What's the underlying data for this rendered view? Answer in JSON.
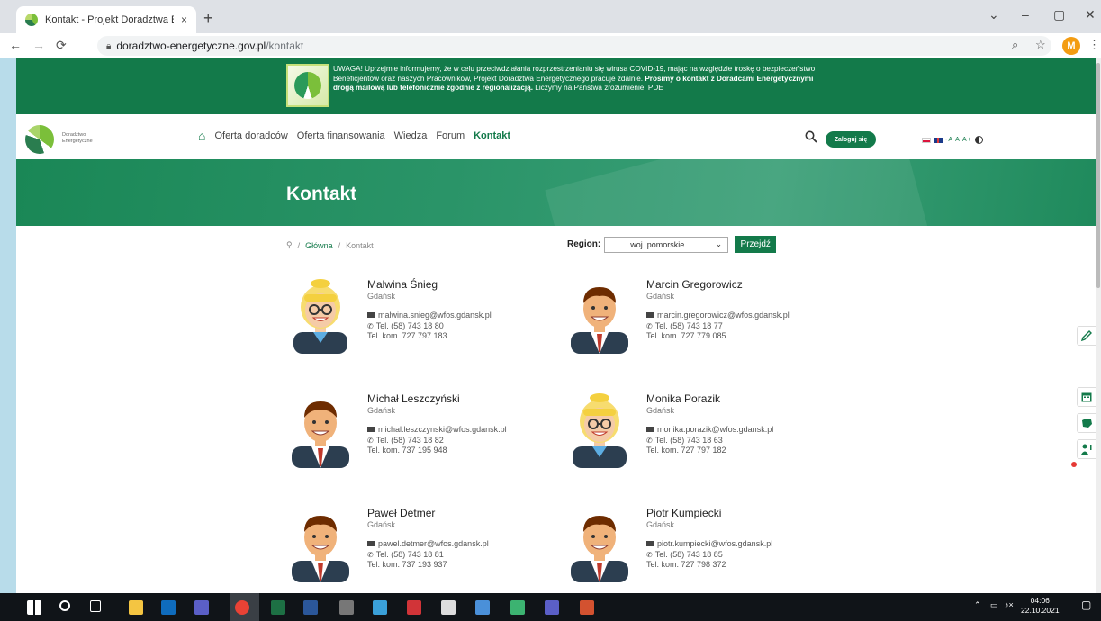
{
  "browser": {
    "tab_title": "Kontakt - Projekt Doradztwa Ene",
    "tab_close": "×",
    "new_tab": "+",
    "url_host": "doradztwo-energetyczne.gov.pl",
    "url_path": "/kontakt",
    "profile_initial": "M",
    "window_controls": {
      "dropdown": "⌄",
      "minimize": "–",
      "maximize": "▢",
      "close": "✕"
    }
  },
  "alert": {
    "text": "UWAGA! Uprzejmie informujemy, że w celu przeciwdziałania rozprzestrzenianiu się wirusa COVID-19, mając na względzie troskę o bezpieczeństwo Beneficjentów oraz naszych Pracowników, Projekt Doradztwa Energetycznego pracuje zdalnie.",
    "bold_text": "Prosimy o kontakt z Doradcami Energetycznymi drogą mailową lub telefonicznie zgodnie z regionalizacją.",
    "tail_text": "Liczymy na Państwa zrozumienie. PDE"
  },
  "site": {
    "logo_text": "Doradztwo Energetyczne",
    "menu": [
      "Oferta doradców",
      "Oferta finansowania",
      "Wiedza",
      "Forum",
      "Kontakt"
    ],
    "login_label": "Zaloguj się",
    "font_sizes": "-A A A+"
  },
  "hero": {
    "title": "Kontakt"
  },
  "breadcrumb": {
    "home": "Główna",
    "current": "Kontakt",
    "sep": "/"
  },
  "region": {
    "label": "Region:",
    "selected": "woj. pomorskie",
    "go_label": "Przejdź"
  },
  "contacts": [
    {
      "name": "Malwina Śnieg",
      "city": "Gdańsk",
      "email": "malwina.snieg@wfos.gdansk.pl",
      "tel": "Tel. (58) 743 18 80",
      "mobile": "Tel. kom. 727 797 183",
      "gender": "female"
    },
    {
      "name": "Marcin Gregorowicz",
      "city": "Gdańsk",
      "email": "marcin.gregorowicz@wfos.gdansk.pl",
      "tel": "Tel. (58) 743 18 77",
      "mobile": "Tel. kom. 727 779 085",
      "gender": "male"
    },
    {
      "name": "Michał Leszczyński",
      "city": "Gdańsk",
      "email": "michal.leszczynski@wfos.gdansk.pl",
      "tel": "Tel. (58) 743 18 82",
      "mobile": "Tel. kom. 737 195 948",
      "gender": "male"
    },
    {
      "name": "Monika Porazik",
      "city": "Gdańsk",
      "email": "monika.porazik@wfos.gdansk.pl",
      "tel": "Tel. (58) 743 18 63",
      "mobile": "Tel. kom. 727 797 182",
      "gender": "female"
    },
    {
      "name": "Paweł Detmer",
      "city": "Gdańsk",
      "email": "pawel.detmer@wfos.gdansk.pl",
      "tel": "Tel. (58) 743 18 81",
      "mobile": "Tel. kom. 737 193 937",
      "gender": "male"
    },
    {
      "name": "Piotr Kumpiecki",
      "city": "Gdańsk",
      "email": "piotr.kumpiecki@wfos.gdansk.pl",
      "tel": "Tel. (58) 743 18 85",
      "mobile": "Tel. kom. 727 798 372",
      "gender": "male"
    }
  ],
  "taskbar": {
    "time": "04:06",
    "date": "22.10.2021",
    "icons": [
      "windows-start",
      "search",
      "task-view",
      "file-explorer",
      "outlook",
      "teams-meeting",
      "chrome",
      "excel",
      "word",
      "calculator",
      "paint",
      "security",
      "network-app",
      "app",
      "app2",
      "teams",
      "powerpoint"
    ]
  },
  "colors": {
    "brand_green": "#137a4a",
    "hero_green": "#2a9468"
  }
}
